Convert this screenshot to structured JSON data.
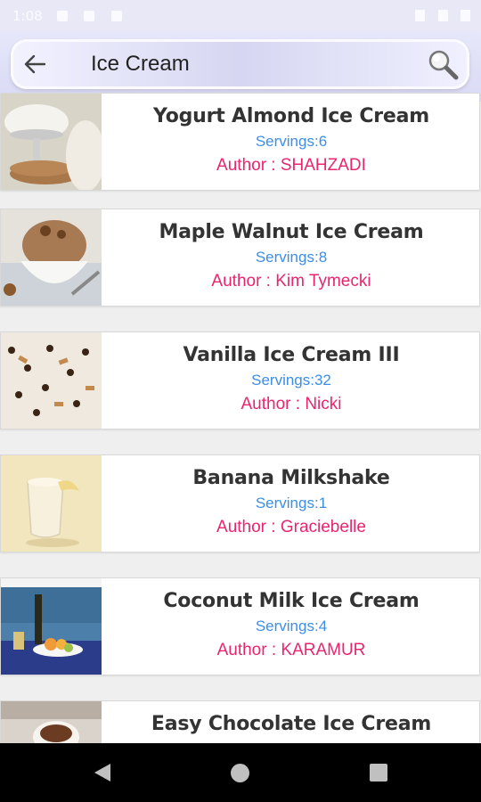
{
  "status_bar": {
    "time": "1:08"
  },
  "search": {
    "query": "Ice Cream"
  },
  "recipes": [
    {
      "title": "Yogurt Almond Ice Cream",
      "servings": "Servings:6",
      "author": "Author : SHAHZADI",
      "thumb": "yogurt-almond-ice-cream-photo"
    },
    {
      "title": "Maple Walnut Ice Cream",
      "servings": "Servings:8",
      "author": "Author : Kim Tymecki",
      "thumb": "maple-walnut-ice-cream-photo"
    },
    {
      "title": "Vanilla Ice Cream III",
      "servings": "Servings:32",
      "author": "Author : Nicki",
      "thumb": "vanilla-ice-cream-photo"
    },
    {
      "title": "Banana Milkshake",
      "servings": "Servings:1",
      "author": "Author : Graciebelle",
      "thumb": "banana-milkshake-photo"
    },
    {
      "title": "Coconut Milk Ice Cream",
      "servings": "Servings:4",
      "author": "Author : KARAMUR",
      "thumb": "coconut-milk-ice-cream-photo"
    },
    {
      "title": "Easy Chocolate Ice Cream",
      "servings": "",
      "author": "",
      "thumb": "chocolate-ice-cream-photo"
    }
  ],
  "colors": {
    "servings": "#3c8ee6",
    "author": "#e9256f",
    "title": "#333333",
    "header": "#e6e7fa"
  },
  "icons": {
    "back": "arrow-left-icon",
    "search": "magnifier-icon",
    "nav_back": "triangle-back-icon",
    "nav_home": "circle-home-icon",
    "nav_recent": "square-recents-icon"
  }
}
